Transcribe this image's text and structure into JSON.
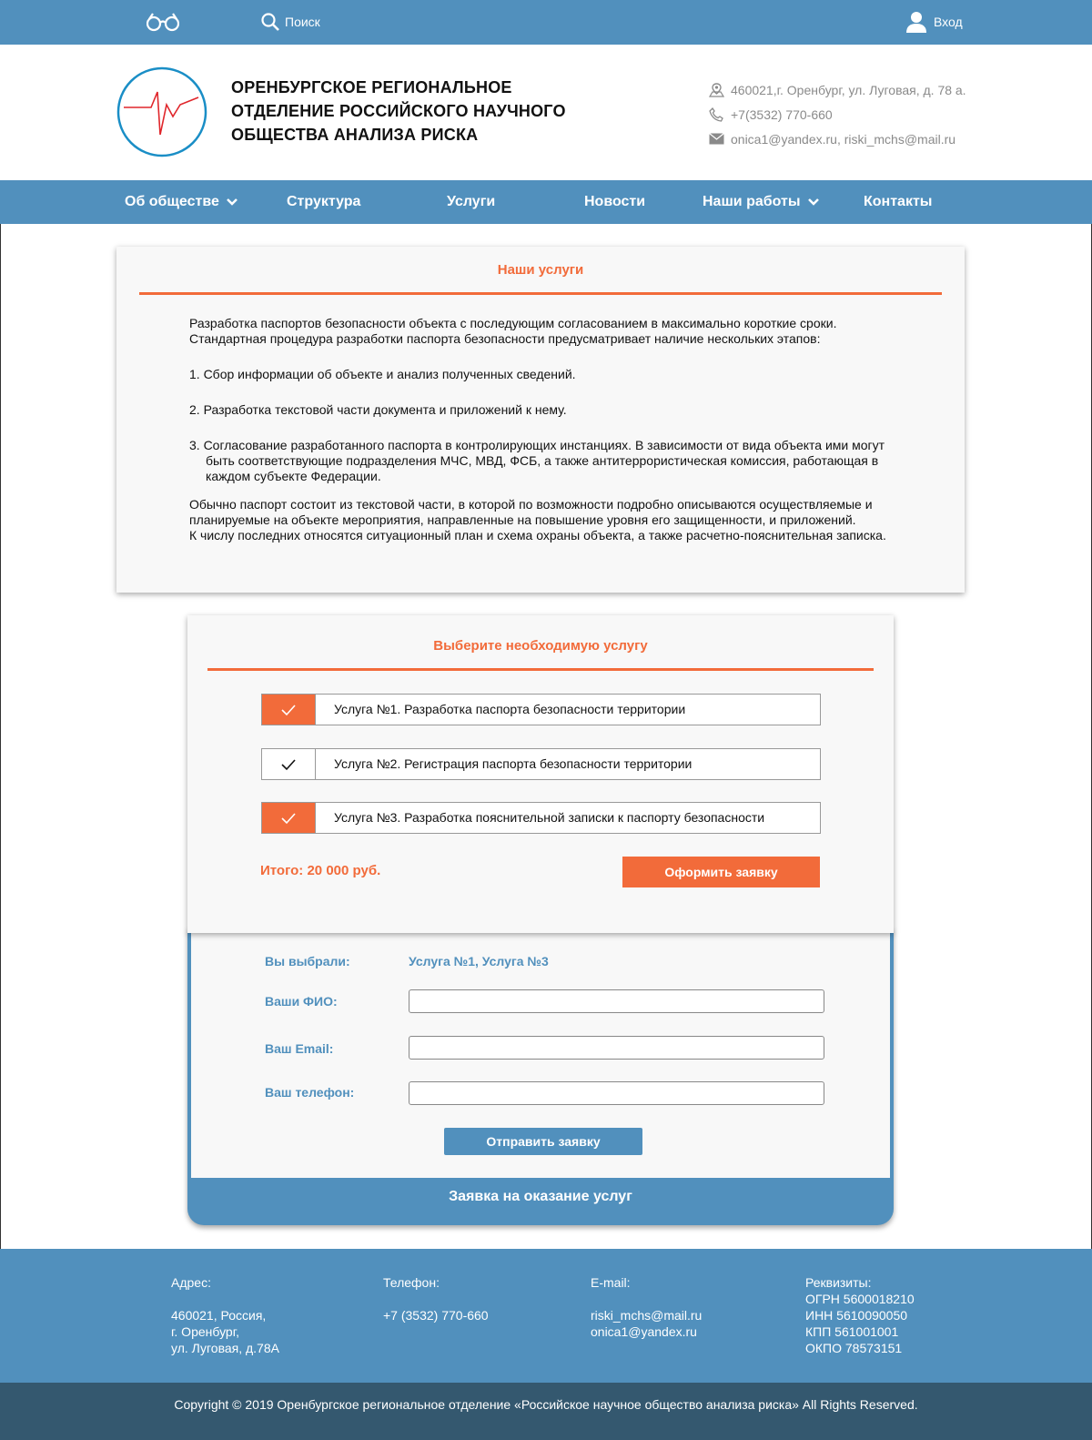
{
  "topbar": {
    "search_label": "Поиск",
    "login_label": "Вход"
  },
  "header": {
    "title_line1": "ОРЕНБУРГСКОЕ РЕГИОНАЛЬНОЕ",
    "title_line2": "ОТДЕЛЕНИЕ РОССИЙСКОГО НАУЧНОГО",
    "title_line3": "ОБЩЕСТВА АНАЛИЗА РИСКА",
    "address": "460021,г. Оренбург, ул. Луговая, д. 78 а.",
    "phone": "+7(3532) 770-660",
    "email": "onica1@yandex.ru, riski_mchs@mail.ru"
  },
  "nav": {
    "items": [
      {
        "label": "Об обществе"
      },
      {
        "label": "Структура"
      },
      {
        "label": "Услуги"
      },
      {
        "label": "Новости"
      },
      {
        "label": "Наши работы"
      },
      {
        "label": "Контакты"
      }
    ]
  },
  "services_card": {
    "title": "Наши услуги",
    "p1a": "Разработка паспортов безопасности объекта с последующим согласованием в максимально короткие сроки.",
    "p1b": "Стандартная процедура разработки паспорта безопасности предусматривает наличие нескольких этапов:",
    "step1": "1. Сбор информации об объекте и анализ полученных сведений.",
    "step2": "2. Разработка текстовой части документа и приложений к нему.",
    "step3a": "3. Согласование разработанного паспорта в контролирующих инстанциях. В зависимости от вида объекта ими могут",
    "step3b": "быть соответствующие подразделения МЧС, МВД, ФСБ, а также антитеррористическая комиссия, работающая в",
    "step3c": "каждом субъекте Федерации.",
    "p2a": "Обычно паспорт состоит из текстовой части, в которой по возможности подробно описываются осуществляемые и",
    "p2b": "планируемые на объекте мероприятия, направленные на повышение уровня его защищенности, и приложений.",
    "p2c": "К числу последних относятся ситуационный план и схема охраны объекта, а также расчетно-пояснительная записка."
  },
  "selection": {
    "title": "Выберите необходимую услугу",
    "services": [
      {
        "label": "Услуга №1. Разработка паспорта безопасности территории",
        "checked": true
      },
      {
        "label": "Услуга №2. Регистрация паспорта безопасности территории",
        "checked": false
      },
      {
        "label": "Услуга №3. Разработка пояснительной записки к паспорту безопасности",
        "checked": true
      }
    ],
    "total": "Итого: 20 000 руб.",
    "order_button": "Оформить заявку"
  },
  "form": {
    "chosen_label": "Вы выбрали:",
    "chosen_value": "Услуга №1, Услуга №3",
    "name_label": "Ваши ФИО:",
    "name_value": "",
    "email_label": "Ваш Email:",
    "email_value": "",
    "phone_label": "Ваш телефон:",
    "phone_value": "",
    "send_button": "Отправить заявку",
    "bottom_title": "Заявка на оказание услуг"
  },
  "footer": {
    "address_heading": "Адрес:",
    "address_line1": "460021, Россия,",
    "address_line2": "г. Оренбург,",
    "address_line3": "ул. Луговая, д.78А",
    "phone_heading": "Телефон:",
    "phone_value": "+7 (3532) 770-660",
    "email_heading": "E-mail:",
    "email_line1": "riski_mchs@mail.ru",
    "email_line2": "onica1@yandex.ru",
    "requisites_heading": "Реквизиты:",
    "ogrn": "ОГРН 5600018210",
    "inn": "ИНН 5610090050",
    "kpp": "КПП 561001001",
    "okpo": "ОКПО 78573151",
    "copyright": "Copyright © 2019 Оренбургское региональное отделение «Российское научное общество анализа риска» All Rights Reserved."
  },
  "colors": {
    "primary_blue": "#5190bd",
    "accent_orange": "#f26b3a",
    "dark_footer": "#34586f"
  },
  "icons": [
    "glasses-icon",
    "search-icon",
    "user-icon",
    "location-icon",
    "phone-icon",
    "mail-icon",
    "chevron-down-icon",
    "checkmark-icon"
  ]
}
